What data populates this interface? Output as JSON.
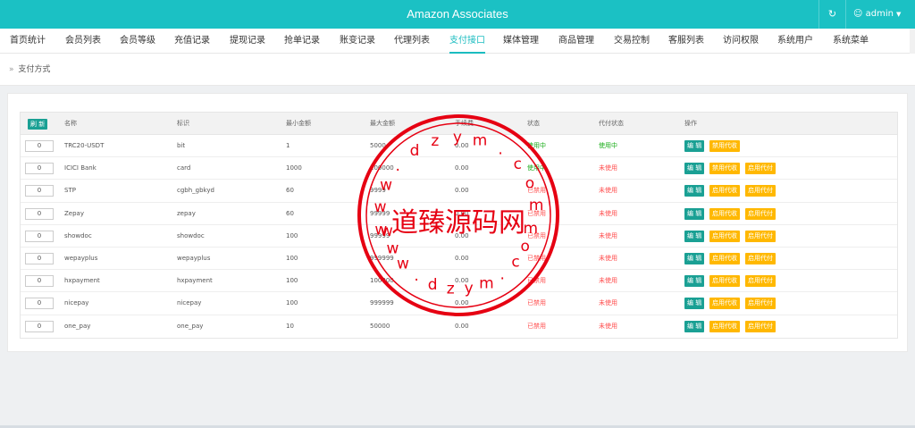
{
  "app": {
    "title": "Amazon Associates",
    "user": "admin"
  },
  "nav": {
    "items": [
      "首页统计",
      "会员列表",
      "会员等级",
      "充值记录",
      "提现记录",
      "抢单记录",
      "账变记录",
      "代理列表",
      "支付接口",
      "媒体管理",
      "商品管理",
      "交易控制",
      "客服列表",
      "访问权限",
      "系统用户",
      "系统菜单"
    ],
    "active_index": 8
  },
  "breadcrumb": {
    "sep": "»",
    "label": "支付方式"
  },
  "table": {
    "refresh_label": "刷 新",
    "headers": [
      "名称",
      "标识",
      "最小金额",
      "最大金额",
      "手续费",
      "状态",
      "代付状态",
      "操作"
    ],
    "rows": [
      {
        "sort": "0",
        "name": "TRC20-USDT",
        "code": "bit",
        "min": "1",
        "max": "5000",
        "fee": "0.00",
        "status": "使用中",
        "payout": "使用中",
        "status_color": "green",
        "payout_color": "green",
        "actions": [
          "编 辑",
          "禁用代收"
        ]
      },
      {
        "sort": "0",
        "name": "ICICI Bank",
        "code": "card",
        "min": "1000",
        "max": "100000",
        "fee": "0.00",
        "status": "使用中",
        "payout": "未使用",
        "status_color": "green",
        "payout_color": "red",
        "actions": [
          "编 辑",
          "禁用代收",
          "启用代付"
        ]
      },
      {
        "sort": "0",
        "name": "STP",
        "code": "cgbh_gbkyd",
        "min": "60",
        "max": "9999",
        "fee": "0.00",
        "status": "已禁用",
        "payout": "未使用",
        "status_color": "red",
        "payout_color": "red",
        "actions": [
          "编 辑",
          "启用代收",
          "启用代付"
        ]
      },
      {
        "sort": "0",
        "name": "Zepay",
        "code": "zepay",
        "min": "60",
        "max": "99999",
        "fee": "0.00",
        "status": "已禁用",
        "payout": "未使用",
        "status_color": "red",
        "payout_color": "red",
        "actions": [
          "编 辑",
          "启用代收",
          "启用代付"
        ]
      },
      {
        "sort": "0",
        "name": "showdoc",
        "code": "showdoc",
        "min": "100",
        "max": "99999",
        "fee": "0.00",
        "status": "已禁用",
        "payout": "未使用",
        "status_color": "red",
        "payout_color": "red",
        "actions": [
          "编 辑",
          "启用代收",
          "启用代付"
        ]
      },
      {
        "sort": "0",
        "name": "wepayplus",
        "code": "wepayplus",
        "min": "100",
        "max": "999999",
        "fee": "0.00",
        "status": "已禁用",
        "payout": "未使用",
        "status_color": "red",
        "payout_color": "red",
        "actions": [
          "编 辑",
          "启用代收",
          "启用代付"
        ]
      },
      {
        "sort": "0",
        "name": "hxpayment",
        "code": "hxpayment",
        "min": "100",
        "max": "100000",
        "fee": "0.00",
        "status": "已禁用",
        "payout": "未使用",
        "status_color": "red",
        "payout_color": "red",
        "actions": [
          "编 辑",
          "启用代收",
          "启用代付"
        ]
      },
      {
        "sort": "0",
        "name": "nicepay",
        "code": "nicepay",
        "min": "100",
        "max": "999999",
        "fee": "0.00",
        "status": "已禁用",
        "payout": "未使用",
        "status_color": "red",
        "payout_color": "red",
        "actions": [
          "编 辑",
          "启用代收",
          "启用代付"
        ]
      },
      {
        "sort": "0",
        "name": "one_pay",
        "code": "one_pay",
        "min": "10",
        "max": "50000",
        "fee": "0.00",
        "status": "已禁用",
        "payout": "未使用",
        "status_color": "red",
        "payout_color": "red",
        "actions": [
          "编 辑",
          "启用代收",
          "启用代付"
        ]
      }
    ]
  },
  "watermark": {
    "text": "道臻源码网",
    "ring_text": "www.dzym.com"
  },
  "colors": {
    "accent": "#1bc1c4",
    "edit_button": "#1aa094",
    "action_button": "#ffb800",
    "active": "#1aad19",
    "inactive": "#ff4d4d",
    "stamp": "#e60012"
  },
  "icons": {
    "refresh": "refresh-icon",
    "user": "user-icon",
    "caret": "caret-down-icon"
  }
}
